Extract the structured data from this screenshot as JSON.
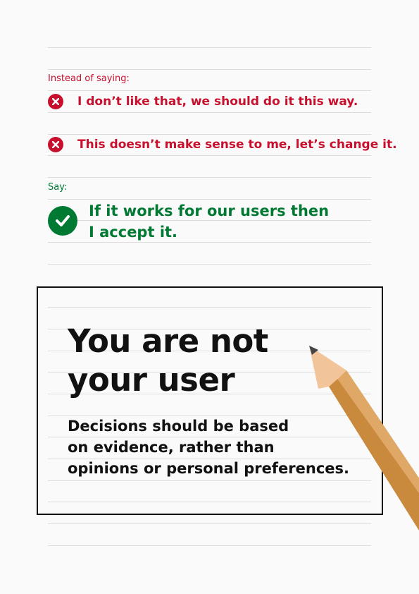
{
  "instead_label": "Instead of saying:",
  "bad_statements": [
    {
      "icon": "close-icon",
      "text": "I don’t like that, we should do it this way."
    },
    {
      "icon": "close-icon",
      "text": "This doesn’t make sense to me, let’s change it."
    }
  ],
  "say_label": "Say:",
  "good_statement": {
    "icon": "checkmark-icon",
    "line1": "If it works for our users then",
    "line2": "I accept it."
  },
  "card": {
    "title_line1": "You are not",
    "title_line2": "your user",
    "body_line1": "Decisions should be based",
    "body_line2": "on evidence, rather than",
    "body_line3": "opinions or personal preferences."
  },
  "colors": {
    "red": "#c8102e",
    "green": "#007a33",
    "rule": "#dcdcdc",
    "pencil": "#c98a3e"
  }
}
